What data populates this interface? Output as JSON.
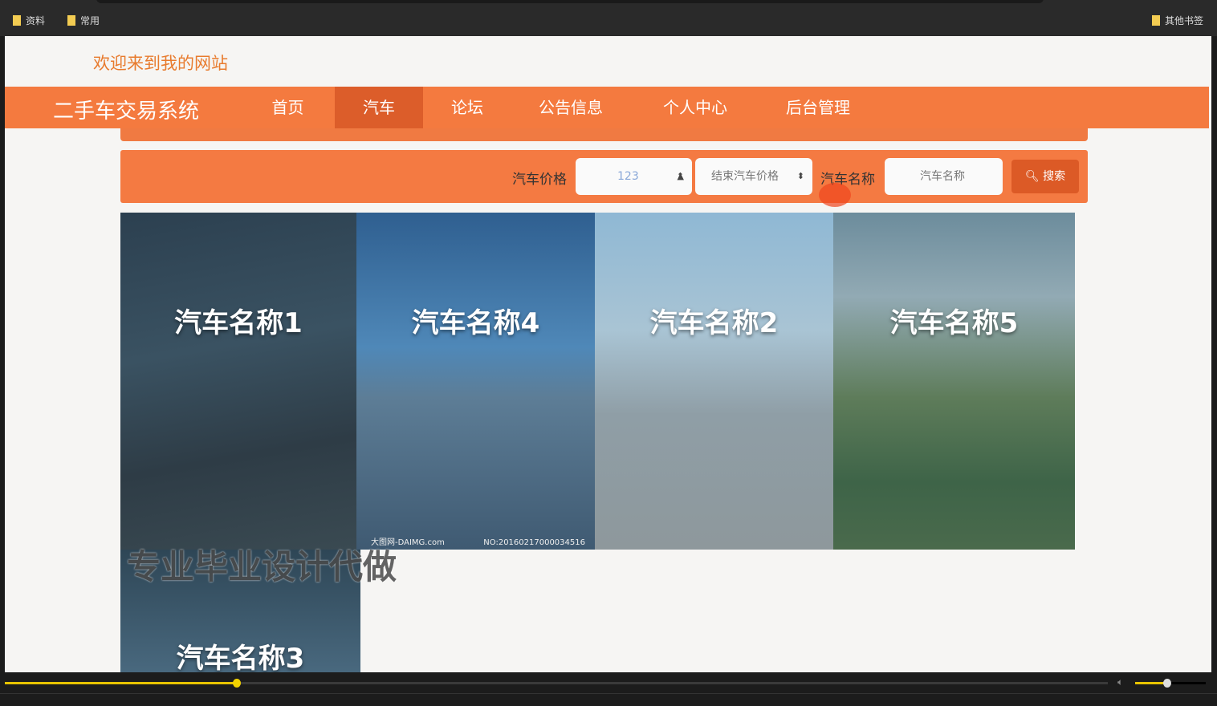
{
  "bookmarks": {
    "items": [
      "资料",
      "常用"
    ],
    "other": "其他书签"
  },
  "header": {
    "welcome": "欢迎来到我的网站"
  },
  "nav": {
    "brand": "二手车交易系统",
    "tabs": [
      "首页",
      "汽车",
      "论坛",
      "公告信息",
      "个人中心",
      "后台管理"
    ],
    "active": "汽车"
  },
  "search": {
    "price_label": "汽车价格",
    "price_start_value": "123",
    "price_end_placeholder": "结束汽车价格",
    "name_label": "汽车名称",
    "name_placeholder": "汽车名称",
    "button": "搜索"
  },
  "cars": [
    {
      "name": "汽车名称1"
    },
    {
      "name": "汽车名称4",
      "image_text": [
        "大图网-DAIMG.com",
        "NO:20160217000034516"
      ]
    },
    {
      "name": "汽车名称2"
    },
    {
      "name": "汽车名称5"
    },
    {
      "name": "汽车名称3"
    }
  ],
  "watermark": "专业毕业设计代做",
  "player": {
    "progress": 0.21,
    "volume": 0.45
  },
  "colors": {
    "accent": "#f47a3f",
    "active_tab": "#dc5d2a",
    "progress": "#e8c400"
  }
}
